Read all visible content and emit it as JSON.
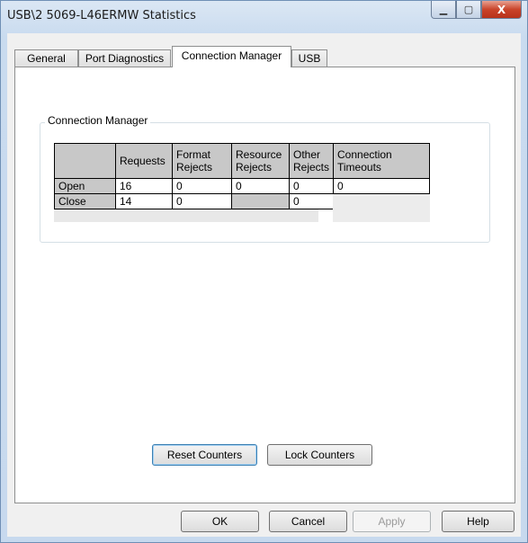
{
  "window": {
    "title": "USB\\2 5069-L46ERMW Statistics",
    "controls": {
      "minimize": "▁",
      "maximize": "▢",
      "close": "X"
    }
  },
  "tabs": [
    {
      "label": "General"
    },
    {
      "label": "Port Diagnostics"
    },
    {
      "label": "Connection Manager",
      "active": true
    },
    {
      "label": "USB"
    }
  ],
  "connection_manager": {
    "group_label": "Connection Manager",
    "columns": [
      "Requests",
      "Format\nRejects",
      "Resource\nRejects",
      "Other\nRejects"
    ],
    "rows": [
      {
        "label": "Open",
        "values": [
          "16",
          "0",
          "0",
          "0"
        ]
      },
      {
        "label": "Close",
        "values": [
          "14",
          "0",
          "",
          "0"
        ]
      }
    ],
    "timeouts": {
      "header": "Connection\nTimeouts",
      "value": "0"
    }
  },
  "counters": {
    "reset_label": "Reset Counters",
    "lock_label": "Lock Counters"
  },
  "footer": {
    "ok_label": "OK",
    "cancel_label": "Cancel",
    "apply_label": "Apply",
    "help_label": "Help"
  }
}
